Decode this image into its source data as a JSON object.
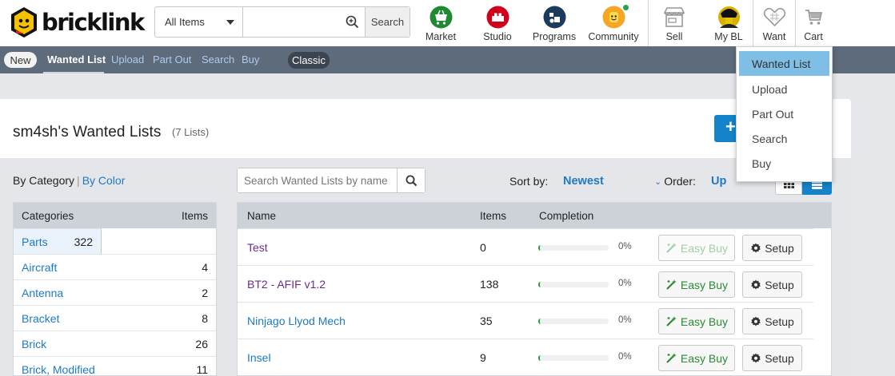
{
  "header": {
    "logo_text": "bricklink",
    "search": {
      "category_selected": "All Items",
      "query_value": "",
      "button_label": "Search"
    },
    "nav": [
      {
        "key": "market",
        "label": "Market",
        "icon": "market-icon",
        "color": "#1f8a33"
      },
      {
        "key": "studio",
        "label": "Studio",
        "icon": "studio-icon",
        "color": "#d0021b"
      },
      {
        "key": "programs",
        "label": "Programs",
        "icon": "programs-icon",
        "color": "#1b3a5c"
      },
      {
        "key": "community",
        "label": "Community",
        "icon": "community-icon",
        "color": "#f5a623"
      },
      {
        "key": "sell",
        "label": "Sell",
        "icon": "store-icon"
      },
      {
        "key": "mybl",
        "label": "My BL",
        "icon": "avatar"
      },
      {
        "key": "want",
        "label": "Want",
        "icon": "heart-icon"
      },
      {
        "key": "cart",
        "label": "Cart",
        "icon": "cart-icon"
      }
    ]
  },
  "subnav": {
    "new_label": "New",
    "links": [
      "Wanted List",
      "Upload",
      "Part Out",
      "Search",
      "Buy"
    ],
    "classic_label": "Classic"
  },
  "page": {
    "title": "sm4sh's Wanted Lists",
    "count": "(7 Lists)",
    "new_button": "+"
  },
  "filter": {
    "by_category": "By Category",
    "separator": "|",
    "by_color": "By Color"
  },
  "categories": {
    "header_name": "Categories",
    "header_items": "Items",
    "rows": [
      {
        "name": "Parts",
        "count": "322"
      },
      {
        "name": "Aircraft",
        "count": "4"
      },
      {
        "name": "Antenna",
        "count": "2"
      },
      {
        "name": "Bracket",
        "count": "8"
      },
      {
        "name": "Brick",
        "count": "26"
      },
      {
        "name": "Brick, Modified",
        "count": "11"
      }
    ]
  },
  "wl_search": {
    "placeholder": "Search Wanted Lists by name"
  },
  "sort": {
    "label": "Sort by:",
    "value": "Newest",
    "order_label": "Order:",
    "order_value": "Up"
  },
  "wanted_lists": {
    "headers": {
      "name": "Name",
      "items": "Items",
      "completion": "Completion"
    },
    "rows": [
      {
        "name": "Test",
        "items": "0",
        "completion": "0%",
        "completion_fraction": 0,
        "easy_buy": "Easy Buy",
        "setup": "Setup"
      },
      {
        "name": "BT2 - AFIF v1.2",
        "items": "138",
        "completion": "0%",
        "completion_fraction": 0,
        "easy_buy": "Easy Buy",
        "setup": "Setup"
      },
      {
        "name": "Ninjago Llyod Mech",
        "items": "35",
        "completion": "0%",
        "completion_fraction": 0,
        "easy_buy": "Easy Buy",
        "setup": "Setup"
      },
      {
        "name": "Insel",
        "items": "9",
        "completion": "0%",
        "completion_fraction": 0,
        "easy_buy": "Easy Buy",
        "setup": "Setup"
      }
    ]
  },
  "want_menu": {
    "items": [
      "Wanted List",
      "Upload",
      "Part Out",
      "Search",
      "Buy"
    ],
    "active": "Wanted List"
  },
  "colors": {
    "accent_blue": "#1583c9",
    "link_blue": "#1f7ac2",
    "visited_purple": "#6a2b8c",
    "easy_buy_green": "#2c8a35",
    "subnav_bg": "#5e6b7a"
  }
}
